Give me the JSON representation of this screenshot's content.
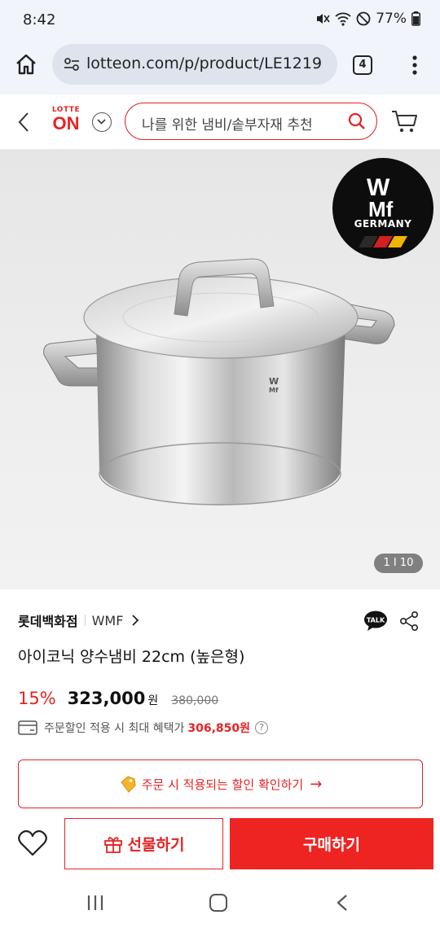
{
  "status_bar": {
    "time": "8:42",
    "battery": "77%"
  },
  "browser": {
    "url": "lotteon.com/p/product/LE1219",
    "tab_count": "4"
  },
  "header": {
    "logo_top": "LOTTE",
    "logo_main": "ON",
    "search_placeholder": "나를 위한 냄비/솥부자재 추천"
  },
  "product_image": {
    "badge_country": "GERMANY",
    "counter": "1 I 10"
  },
  "product": {
    "store": "롯데백화점",
    "brand": "WMF",
    "title": "아이코닉 양수냄비 22cm (높은형)",
    "discount": "15%",
    "price": "323,000",
    "price_unit": "원",
    "original_price": "380,000",
    "benefit_label": "주문할인 적용 시 최대 혜택가",
    "benefit_price": "306,850원"
  },
  "actions": {
    "discount_check": "주문 시 적용되는 할인 확인하기",
    "gift": "선물하기",
    "buy": "구매하기"
  },
  "colors": {
    "accent": "#e62323",
    "buy_bg": "#ee2422"
  }
}
